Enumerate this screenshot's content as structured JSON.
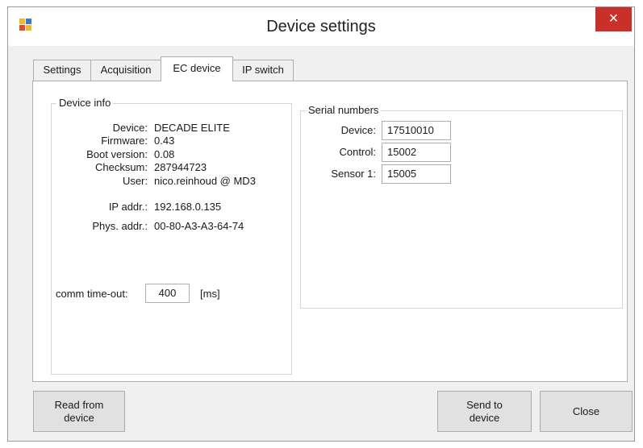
{
  "window": {
    "title": "Device settings",
    "close_glyph": "×"
  },
  "tabs": [
    {
      "label": "Settings"
    },
    {
      "label": "Acquisition"
    },
    {
      "label": "EC device",
      "active": true
    },
    {
      "label": "IP switch"
    }
  ],
  "device_info": {
    "title": "Device info",
    "device_label": "Device:",
    "device_value": "DECADE ELITE",
    "firmware_label": "Firmware:",
    "firmware_value": "0.43",
    "boot_label": "Boot version:",
    "boot_value": "0.08",
    "checksum_label": "Checksum:",
    "checksum_value": "287944723",
    "user_label": "User:",
    "user_value": "nico.reinhoud @ MD3",
    "ip_label": "IP addr.:",
    "ip_value": "192.168.0.135",
    "phys_label": "Phys. addr.:",
    "phys_value": "00-80-A3-A3-64-74",
    "timeout_label": "comm time-out:",
    "timeout_value": "400",
    "timeout_unit": "[ms]"
  },
  "serial_numbers": {
    "title": "Serial numbers",
    "device_label": "Device:",
    "device_value": "17510010",
    "control_label": "Control:",
    "control_value": "15002",
    "sensor_label": "Sensor 1:",
    "sensor_value": "15005"
  },
  "buttons": {
    "read_line1": "Read from",
    "read_line2": "device",
    "send_line1": "Send to",
    "send_line2": "device",
    "close": "Close"
  },
  "colors": {
    "close_button": "#c7312a",
    "panel_bg": "#ffffff",
    "window_bg": "#f0f0f0"
  }
}
